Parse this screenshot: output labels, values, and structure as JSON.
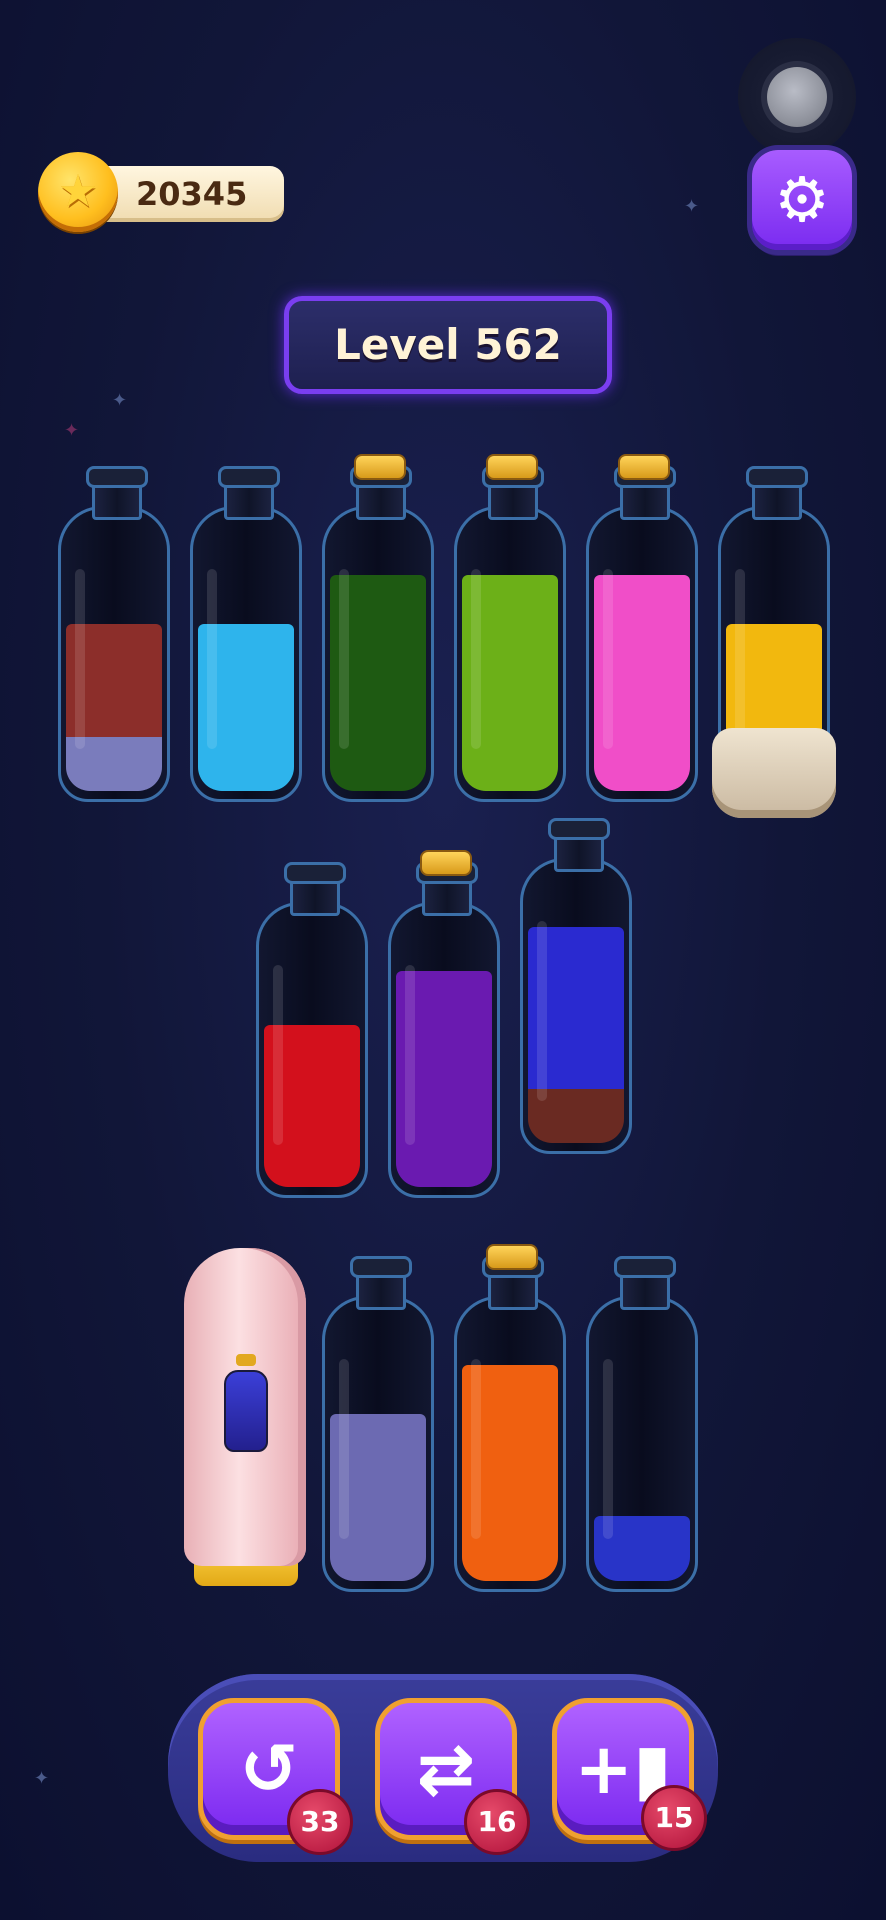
{
  "coins": "20345",
  "level": "Level 562",
  "settings_icon": "gear-icon",
  "bottles": [
    {
      "name": "bottle-1",
      "corked": false,
      "layers": [
        {
          "color": "#7a7cbc",
          "frac": 0.2
        },
        {
          "color": "#8c2e2a",
          "frac": 0.42
        }
      ]
    },
    {
      "name": "bottle-2",
      "corked": false,
      "layers": [
        {
          "color": "#2eb4ec",
          "frac": 0.62
        }
      ]
    },
    {
      "name": "bottle-3",
      "corked": true,
      "layers": [
        {
          "color": "#1e5a12",
          "frac": 0.8
        }
      ]
    },
    {
      "name": "bottle-4",
      "corked": true,
      "layers": [
        {
          "color": "#6cb018",
          "frac": 0.8
        }
      ]
    },
    {
      "name": "bottle-5",
      "corked": true,
      "layers": [
        {
          "color": "#f04ec8",
          "frac": 0.8
        }
      ]
    },
    {
      "name": "bottle-6",
      "corked": false,
      "layers": [
        {
          "color": "#f2b80e",
          "frac": 0.62
        }
      ]
    },
    {
      "name": "bottle-7",
      "corked": false,
      "layers": [
        {
          "color": "#d3101c",
          "frac": 0.6
        }
      ]
    },
    {
      "name": "bottle-8",
      "corked": true,
      "layers": [
        {
          "color": "#6a1ab0",
          "frac": 0.8
        }
      ]
    },
    {
      "name": "bottle-9",
      "corked": false,
      "layers": [
        {
          "color": "#6a2a22",
          "frac": 0.2
        },
        {
          "color": "#2a2ad0",
          "frac": 0.6
        }
      ]
    },
    {
      "name": "bottle-11",
      "corked": false,
      "layers": [
        {
          "color": "#6c6ab2",
          "frac": 0.62
        }
      ]
    },
    {
      "name": "bottle-12",
      "corked": true,
      "layers": [
        {
          "color": "#f06010",
          "frac": 0.8
        }
      ]
    },
    {
      "name": "bottle-13",
      "corked": false,
      "layers": [
        {
          "color": "#2834c8",
          "frac": 0.24
        }
      ]
    }
  ],
  "tools": [
    {
      "name": "undo-button",
      "icon": "undo-icon",
      "count": "33"
    },
    {
      "name": "shuffle-button",
      "icon": "shuffle-icon",
      "count": "16"
    },
    {
      "name": "add-bottle-button",
      "icon": "add-bottle-icon",
      "count": "15"
    }
  ]
}
